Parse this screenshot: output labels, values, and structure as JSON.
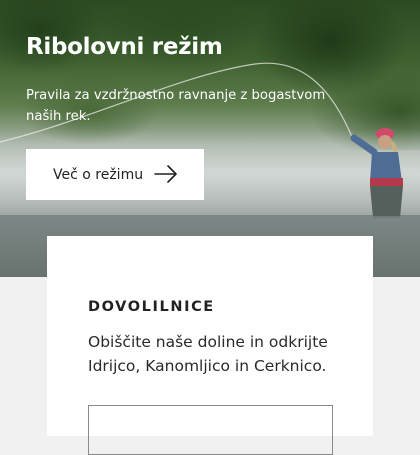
{
  "hero": {
    "title": "Ribolovni režim",
    "subtitle": "Pravila za vzdržnostno ravnanje z bogastvom naših rek.",
    "button_label": "Več o režimu",
    "button_icon": "arrow-right-icon"
  },
  "permits_card": {
    "heading": "DOVOLILNICE",
    "text": "Obiščite naše doline in odkrijte Idrijco, Kanomljico in Cerknico."
  },
  "colors": {
    "card_background": "#ffffff",
    "page_background": "#f1f1f1",
    "text_dark": "#222222"
  }
}
